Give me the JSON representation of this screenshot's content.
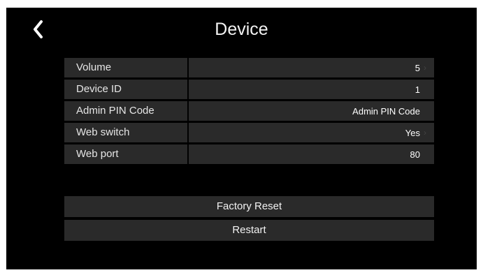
{
  "header": {
    "title": "Device",
    "back_icon": "chevron-left-icon"
  },
  "settings": [
    {
      "label": "Volume",
      "value": "5",
      "has_chevron": true
    },
    {
      "label": "Device ID",
      "value": "1",
      "has_chevron": false
    },
    {
      "label": "Admin PIN Code",
      "value": "Admin PIN Code",
      "has_chevron": false
    },
    {
      "label": "Web switch",
      "value": "Yes",
      "has_chevron": true
    },
    {
      "label": "Web port",
      "value": "80",
      "has_chevron": false
    }
  ],
  "actions": {
    "factory_reset": "Factory Reset",
    "restart": "Restart"
  },
  "colors": {
    "background": "#000000",
    "row_background": "#2a2a2a",
    "text": "#ffffff"
  }
}
